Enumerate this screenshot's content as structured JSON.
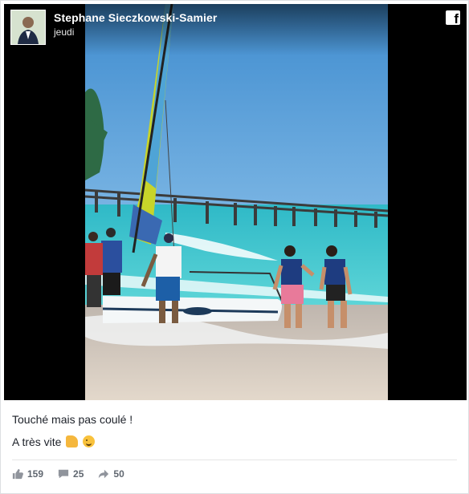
{
  "post": {
    "author": "Stephane Sieczkowski-Samier",
    "date": "jeudi",
    "brand_icon": "facebook-icon",
    "text_line1": "Touché mais pas coulé !",
    "text_line2": "A très vite",
    "emojis": [
      "thumbs-up-icon",
      "winking-face-icon"
    ]
  },
  "stats": {
    "likes": "159",
    "comments": "25",
    "shares": "50"
  },
  "colors": {
    "text": "#1d2129",
    "muted": "#606770",
    "border": "#dddfe2"
  }
}
